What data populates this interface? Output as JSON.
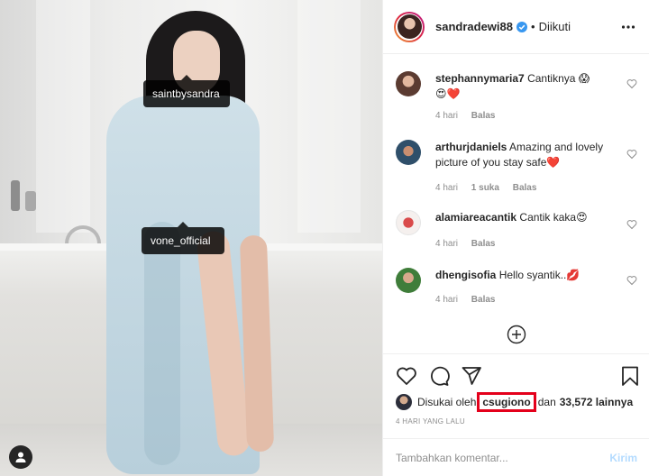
{
  "photo": {
    "tags": [
      "saintbysandra",
      "vone_official"
    ],
    "user_tag_icon": "person-icon"
  },
  "header": {
    "username": "sandradewi88",
    "verified_icon": "verified-badge-icon",
    "separator": "•",
    "follow_status": "Diikuti",
    "more_icon": "more-options-icon"
  },
  "comments": [
    {
      "user": "stephannymaria7",
      "text": "Cantiknya 😱",
      "text2": "😍❤️",
      "time": "4 hari",
      "likes": "",
      "reply": "Balas"
    },
    {
      "user": "arthurjdaniels",
      "text": "Amazing and lovely picture of you stay safe❤️",
      "time": "4 hari",
      "likes": "1 suka",
      "reply": "Balas"
    },
    {
      "user": "alamiareacantik",
      "text": "Cantik kaka😍",
      "time": "4 hari",
      "likes": "",
      "reply": "Balas"
    },
    {
      "user": "dhengisofia",
      "text": "Hello syantik..💋",
      "time": "4 hari",
      "likes": "",
      "reply": "Balas"
    }
  ],
  "actions": {
    "like_icon": "heart-icon",
    "comment_icon": "comment-icon",
    "share_icon": "share-icon",
    "save_icon": "bookmark-icon",
    "load_more_icon": "plus-circle-icon"
  },
  "likes": {
    "prefix": "Disukai oleh",
    "user": "csugiono",
    "connector": "dan",
    "count": "33,572 lainnya"
  },
  "timestamp": "4 HARI YANG LALU",
  "add_comment": {
    "placeholder": "Tambahkan komentar...",
    "post_label": "Kirim"
  },
  "colors": {
    "highlight_box": "#e4001b",
    "verified_blue": "#3897f0",
    "post_button": "#b3dbff",
    "muted_text": "#8e8e8e"
  }
}
